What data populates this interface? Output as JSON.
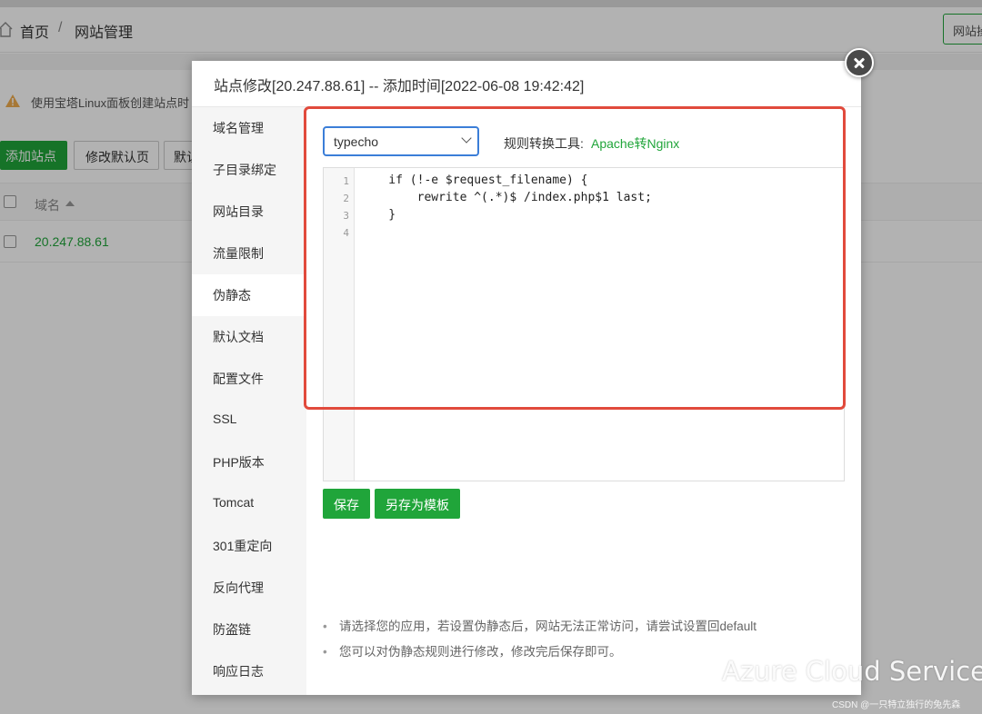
{
  "breadcrumb": {
    "home": "首页",
    "separator": "/",
    "current": "网站管理",
    "right_button": "网站操作"
  },
  "notice": {
    "text": "使用宝塔Linux面板创建站点时"
  },
  "toolbar": {
    "add_site": "添加站点",
    "edit_default_page": "修改默认页",
    "default_btn": "默认"
  },
  "table": {
    "header_domain": "域名",
    "rows": [
      {
        "domain": "20.247.88.61"
      }
    ]
  },
  "modal": {
    "title": "站点修改[20.247.88.61] -- 添加时间[2022-06-08 19:42:42]",
    "sidebar": [
      {
        "label": "域名管理"
      },
      {
        "label": "子目录绑定"
      },
      {
        "label": "网站目录"
      },
      {
        "label": "流量限制"
      },
      {
        "label": "伪静态"
      },
      {
        "label": "默认文档"
      },
      {
        "label": "配置文件"
      },
      {
        "label": "SSL"
      },
      {
        "label": "PHP版本"
      },
      {
        "label": "Tomcat"
      },
      {
        "label": "301重定向"
      },
      {
        "label": "反向代理"
      },
      {
        "label": "防盗链"
      },
      {
        "label": "响应日志"
      }
    ],
    "active_item": "伪静态",
    "app_select": {
      "value": "typecho"
    },
    "rule_tool": {
      "label": "规则转换工具:",
      "link": "Apache转Nginx"
    },
    "editor": {
      "line_numbers": [
        "1",
        "2",
        "3",
        "4"
      ],
      "lines": [
        "    if (!-e $request_filename) {",
        "        rewrite ^(.*)$ /index.php$1 last;",
        "    }",
        ""
      ]
    },
    "buttons": {
      "save": "保存",
      "save_as_template": "另存为模板"
    },
    "tips": [
      "请选择您的应用，若设置伪静态后，网站无法正常访问，请尝试设置回default",
      "您可以对伪静态规则进行修改，修改完后保存即可。"
    ]
  },
  "watermark": {
    "text": "Azure Cloud Service",
    "credit": "CSDN @一只特立独行的兔先森"
  },
  "colors": {
    "accent": "#20a53a",
    "highlight": "#e14a3c",
    "select_border": "#3b7ed8"
  }
}
